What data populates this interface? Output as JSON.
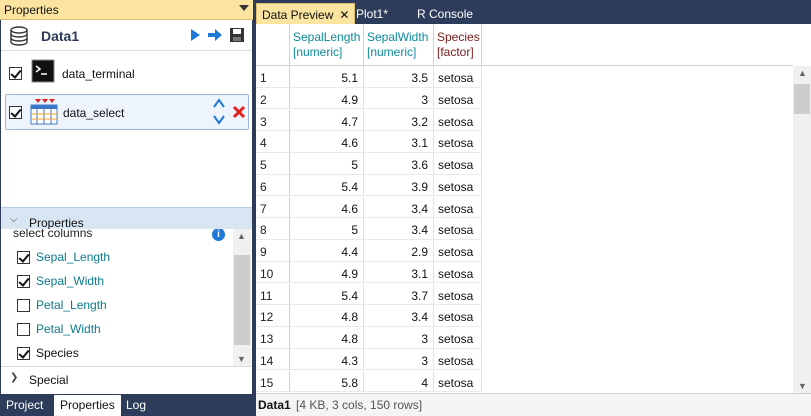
{
  "left_panel": {
    "title": "Properties",
    "data_title": "Data1",
    "steps": [
      {
        "label": "data_terminal",
        "checked": true
      },
      {
        "label": "data_select",
        "checked": true
      }
    ],
    "properties_header": "Properties",
    "section_label": "select columns",
    "columns": [
      {
        "label": "Sepal_Length",
        "checked": true
      },
      {
        "label": "Sepal_Width",
        "checked": true
      },
      {
        "label": "Petal_Length",
        "checked": false
      },
      {
        "label": "Petal_Width",
        "checked": false
      },
      {
        "label": "Species",
        "checked": true
      }
    ],
    "special_label": "Special",
    "bottom_tabs": [
      "Project",
      "Properties",
      "Log"
    ],
    "active_bottom_tab": "Properties"
  },
  "right_panel": {
    "tabs": [
      {
        "label": "Data Preview",
        "closable": true,
        "active": true
      },
      {
        "label": "Plot1*",
        "closable": false,
        "active": false
      },
      {
        "label": "R Console",
        "closable": false,
        "active": false
      }
    ],
    "columns": [
      {
        "name": "SepalLength",
        "type": "[numeric]"
      },
      {
        "name": "SepalWidth",
        "type": "[numeric]"
      },
      {
        "name": "Species",
        "type": "[factor]"
      }
    ],
    "rows": [
      [
        "1",
        "5.1",
        "3.5",
        "setosa"
      ],
      [
        "2",
        "4.9",
        "3",
        "setosa"
      ],
      [
        "3",
        "4.7",
        "3.2",
        "setosa"
      ],
      [
        "4",
        "4.6",
        "3.1",
        "setosa"
      ],
      [
        "5",
        "5",
        "3.6",
        "setosa"
      ],
      [
        "6",
        "5.4",
        "3.9",
        "setosa"
      ],
      [
        "7",
        "4.6",
        "3.4",
        "setosa"
      ],
      [
        "8",
        "5",
        "3.4",
        "setosa"
      ],
      [
        "9",
        "4.4",
        "2.9",
        "setosa"
      ],
      [
        "10",
        "4.9",
        "3.1",
        "setosa"
      ],
      [
        "11",
        "5.4",
        "3.7",
        "setosa"
      ],
      [
        "12",
        "4.8",
        "3.4",
        "setosa"
      ],
      [
        "13",
        "4.8",
        "3",
        "setosa"
      ],
      [
        "14",
        "4.3",
        "3",
        "setosa"
      ],
      [
        "15",
        "5.8",
        "4",
        "setosa"
      ]
    ],
    "status_name": "Data1",
    "status_info": "[4 KB, 3 cols, 150 rows]"
  },
  "colors": {
    "header_bg": "#fbe49f",
    "app_bg": "#2d3c5a",
    "accent_blue": "#1e7ad6",
    "teal_text": "#0b8b9b",
    "delete_red": "#e02020"
  },
  "icons": [
    "database-icon",
    "run-icon",
    "forward-icon",
    "save-icon",
    "terminal-icon",
    "table-select-icon",
    "move-up-icon",
    "move-down-icon",
    "delete-icon",
    "info-icon"
  ]
}
